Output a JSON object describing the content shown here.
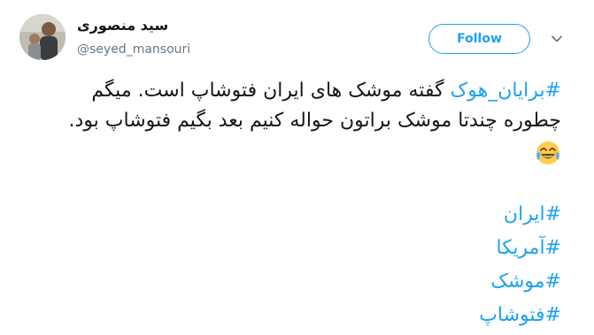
{
  "user": {
    "display_name": "سید منصوری",
    "handle": "@seyed_mansouri"
  },
  "actions": {
    "follow_label": "Follow"
  },
  "tweet": {
    "line1_hashtag": "#برایان_هوک",
    "line1_rest": " گفته موشک های ایران فتوشاپ است. میگم",
    "line2": "چطوره چندتا موشک براتون حواله کنیم بعد بگیم فتوشاپ بود.",
    "emoji": "face-with-tears-of-joy",
    "hashtags": [
      "#ایران",
      "#آمریکا",
      "#موشک",
      "#فتوشاپ"
    ]
  },
  "colors": {
    "accent": "#1da1f2",
    "text": "#14171a",
    "muted": "#657786"
  }
}
